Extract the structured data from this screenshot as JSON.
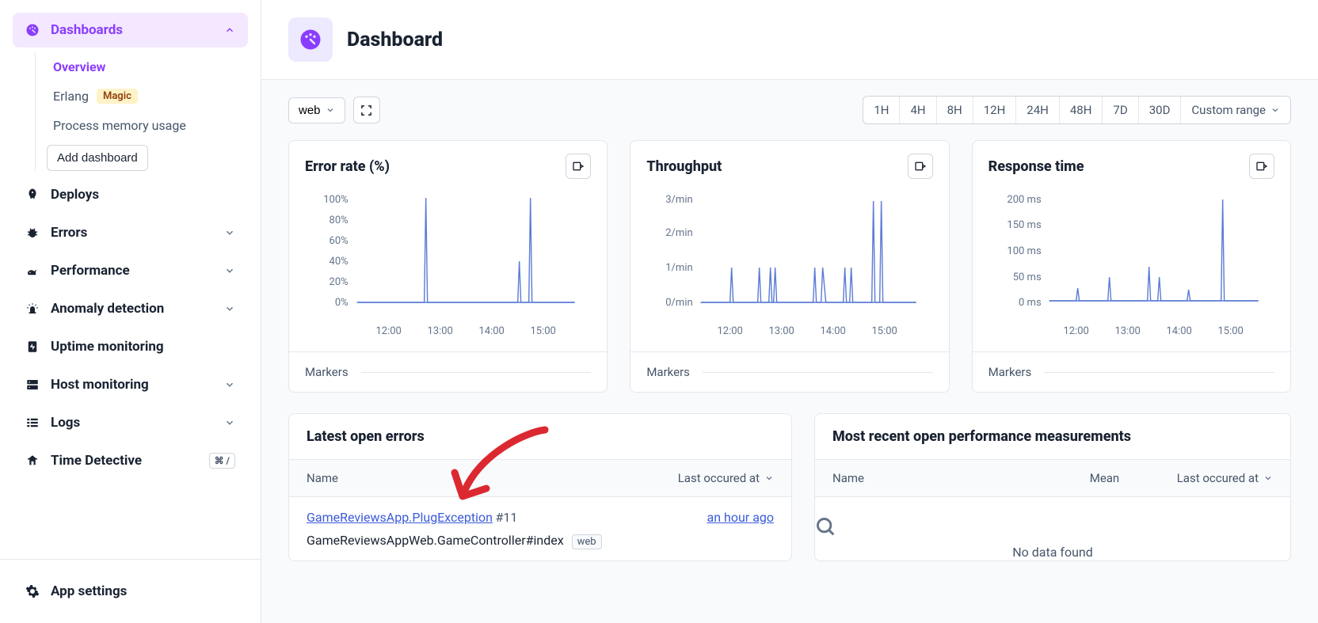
{
  "sidebar": {
    "dashboards": {
      "label": "Dashboards",
      "active": true,
      "items": [
        {
          "label": "Overview",
          "active": true
        },
        {
          "label": "Erlang",
          "badge": "Magic"
        },
        {
          "label": "Process memory usage"
        }
      ],
      "add_label": "Add dashboard"
    },
    "nav": [
      {
        "key": "deploys",
        "label": "Deploys",
        "chevron": false
      },
      {
        "key": "errors",
        "label": "Errors",
        "chevron": true
      },
      {
        "key": "performance",
        "label": "Performance",
        "chevron": true
      },
      {
        "key": "anomaly",
        "label": "Anomaly detection",
        "chevron": true
      },
      {
        "key": "uptime",
        "label": "Uptime monitoring",
        "chevron": false
      },
      {
        "key": "host",
        "label": "Host monitoring",
        "chevron": true
      },
      {
        "key": "logs",
        "label": "Logs",
        "chevron": true
      },
      {
        "key": "time-detective",
        "label": "Time Detective",
        "shortcut": "⌘ /"
      }
    ],
    "settings_label": "App settings"
  },
  "header": {
    "title": "Dashboard"
  },
  "toolbar": {
    "filter_label": "web",
    "time_ranges": [
      "1H",
      "4H",
      "8H",
      "12H",
      "24H",
      "48H",
      "7D",
      "30D"
    ],
    "custom_range_label": "Custom range"
  },
  "cards": {
    "error_rate": {
      "title": "Error rate (%)",
      "markers_label": "Markers"
    },
    "throughput": {
      "title": "Throughput",
      "markers_label": "Markers"
    },
    "response_time": {
      "title": "Response time",
      "markers_label": "Markers"
    }
  },
  "chart_data": [
    {
      "type": "line",
      "title": "Error rate (%)",
      "ylabel": "%",
      "ylim": [
        0,
        100
      ],
      "y_ticks": [
        "100%",
        "80%",
        "60%",
        "40%",
        "20%",
        "0%"
      ],
      "x_ticks": [
        "12:00",
        "13:00",
        "14:00",
        "15:00"
      ],
      "series": [
        {
          "name": "error_rate",
          "spikes": [
            {
              "x": "13:00",
              "value": 100
            },
            {
              "x": "14:45",
              "value": 40
            },
            {
              "x": "15:00",
              "value": 100
            }
          ],
          "baseline": 0
        }
      ]
    },
    {
      "type": "line",
      "title": "Throughput",
      "ylabel": "req/min",
      "ylim": [
        0,
        3
      ],
      "y_ticks": [
        "3/min",
        "2/min",
        "1/min",
        "0/min"
      ],
      "x_ticks": [
        "12:00",
        "13:00",
        "14:00",
        "15:00"
      ],
      "series": [
        {
          "name": "throughput",
          "spikes": [
            {
              "x": "12:20",
              "value": 1
            },
            {
              "x": "12:55",
              "value": 1
            },
            {
              "x": "13:05",
              "value": 1
            },
            {
              "x": "13:08",
              "value": 1
            },
            {
              "x": "13:50",
              "value": 1
            },
            {
              "x": "13:55",
              "value": 1
            },
            {
              "x": "14:15",
              "value": 1
            },
            {
              "x": "14:20",
              "value": 1
            },
            {
              "x": "15:00",
              "value": 3
            },
            {
              "x": "15:05",
              "value": 3
            }
          ],
          "baseline": 0
        }
      ]
    },
    {
      "type": "line",
      "title": "Response time",
      "ylabel": "ms",
      "ylim": [
        0,
        200
      ],
      "y_ticks": [
        "200 ms",
        "150 ms",
        "100 ms",
        "50 ms",
        "0 ms"
      ],
      "x_ticks": [
        "12:00",
        "13:00",
        "14:00",
        "15:00"
      ],
      "series": [
        {
          "name": "response_time",
          "spikes": [
            {
              "x": "12:20",
              "value": 30
            },
            {
              "x": "13:00",
              "value": 50
            },
            {
              "x": "13:45",
              "value": 70
            },
            {
              "x": "13:55",
              "value": 50
            },
            {
              "x": "14:20",
              "value": 25
            },
            {
              "x": "15:00",
              "value": 200
            }
          ],
          "baseline": 3
        }
      ]
    }
  ],
  "errors_panel": {
    "title": "Latest open errors",
    "columns": {
      "name": "Name",
      "last": "Last occured at"
    },
    "rows": [
      {
        "link_text": "GameReviewsApp.PlugException",
        "id": "#11",
        "controller": "GameReviewsAppWeb.GameController#index",
        "tag": "web",
        "last": "an hour ago"
      }
    ]
  },
  "perf_panel": {
    "title": "Most recent open performance measurements",
    "columns": {
      "name": "Name",
      "mean": "Mean",
      "last": "Last occured at"
    },
    "no_data": "No data found"
  }
}
